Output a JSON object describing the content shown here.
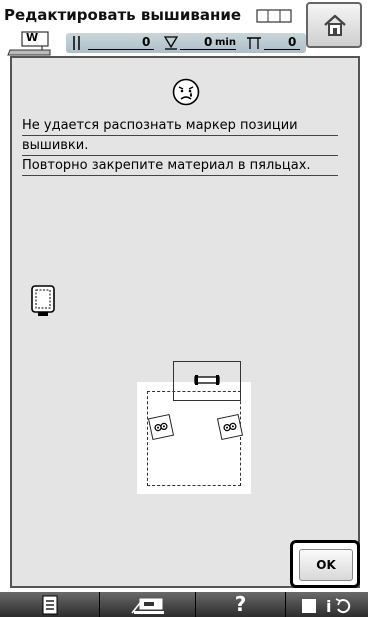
{
  "header": {
    "title": "Редактировать вышивание",
    "presser_foot_label": "W"
  },
  "counter": {
    "stitch_value": "0",
    "time_value": "0",
    "time_unit": "min",
    "color_value": "0"
  },
  "dialog": {
    "lines": [
      "Не удается распознать маркер позиции",
      "вышивки.",
      "Повторно закрепите материал в пяльцах."
    ],
    "ok_label": "OK"
  },
  "toolbar": {
    "help_label": "?"
  },
  "colors": {
    "panel_bg": "#e4e4e4",
    "counter_bg": "#aebfc7",
    "toolbar_bg": "#1b1b1b"
  }
}
